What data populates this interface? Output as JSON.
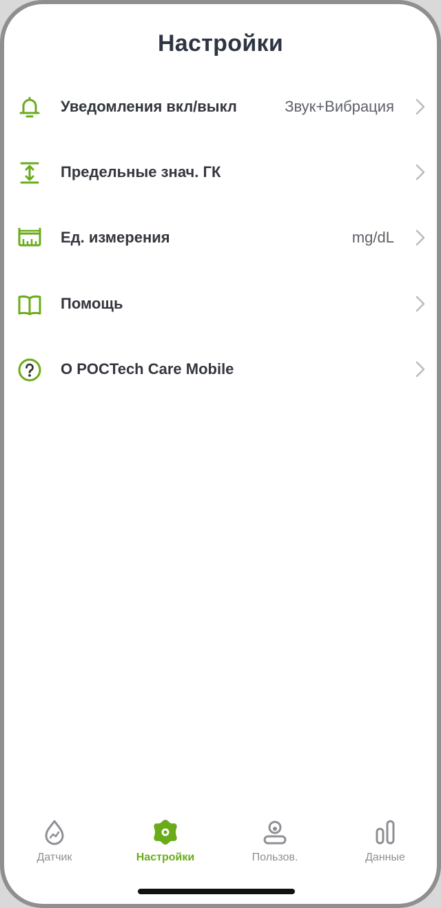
{
  "header": {
    "title": "Настройки"
  },
  "settings": {
    "items": [
      {
        "label": "Уведомления вкл/выкл",
        "value": "Звук+Вибрация",
        "icon": "bell-icon"
      },
      {
        "label": "Предельные знач. ГК",
        "value": "",
        "icon": "range-limits-icon"
      },
      {
        "label": "Ед. измерения",
        "value": "mg/dL",
        "icon": "ruler-icon"
      },
      {
        "label": "Помощь",
        "value": "",
        "icon": "book-icon"
      },
      {
        "label": "О POCTech Care Mobile",
        "value": "",
        "icon": "question-circle-icon"
      }
    ]
  },
  "tabbar": {
    "items": [
      {
        "label": "Датчик",
        "icon": "drop-icon",
        "active": false
      },
      {
        "label": "Настройки",
        "icon": "gear-icon",
        "active": true
      },
      {
        "label": "Пользов.",
        "icon": "user-icon",
        "active": false
      },
      {
        "label": "Данные",
        "icon": "bars-icon",
        "active": false
      }
    ]
  },
  "colors": {
    "accent": "#6aab1a",
    "text_primary": "#33363d",
    "text_secondary": "#5e6168",
    "tab_inactive": "#8d8f94",
    "background": "#ffffff"
  }
}
